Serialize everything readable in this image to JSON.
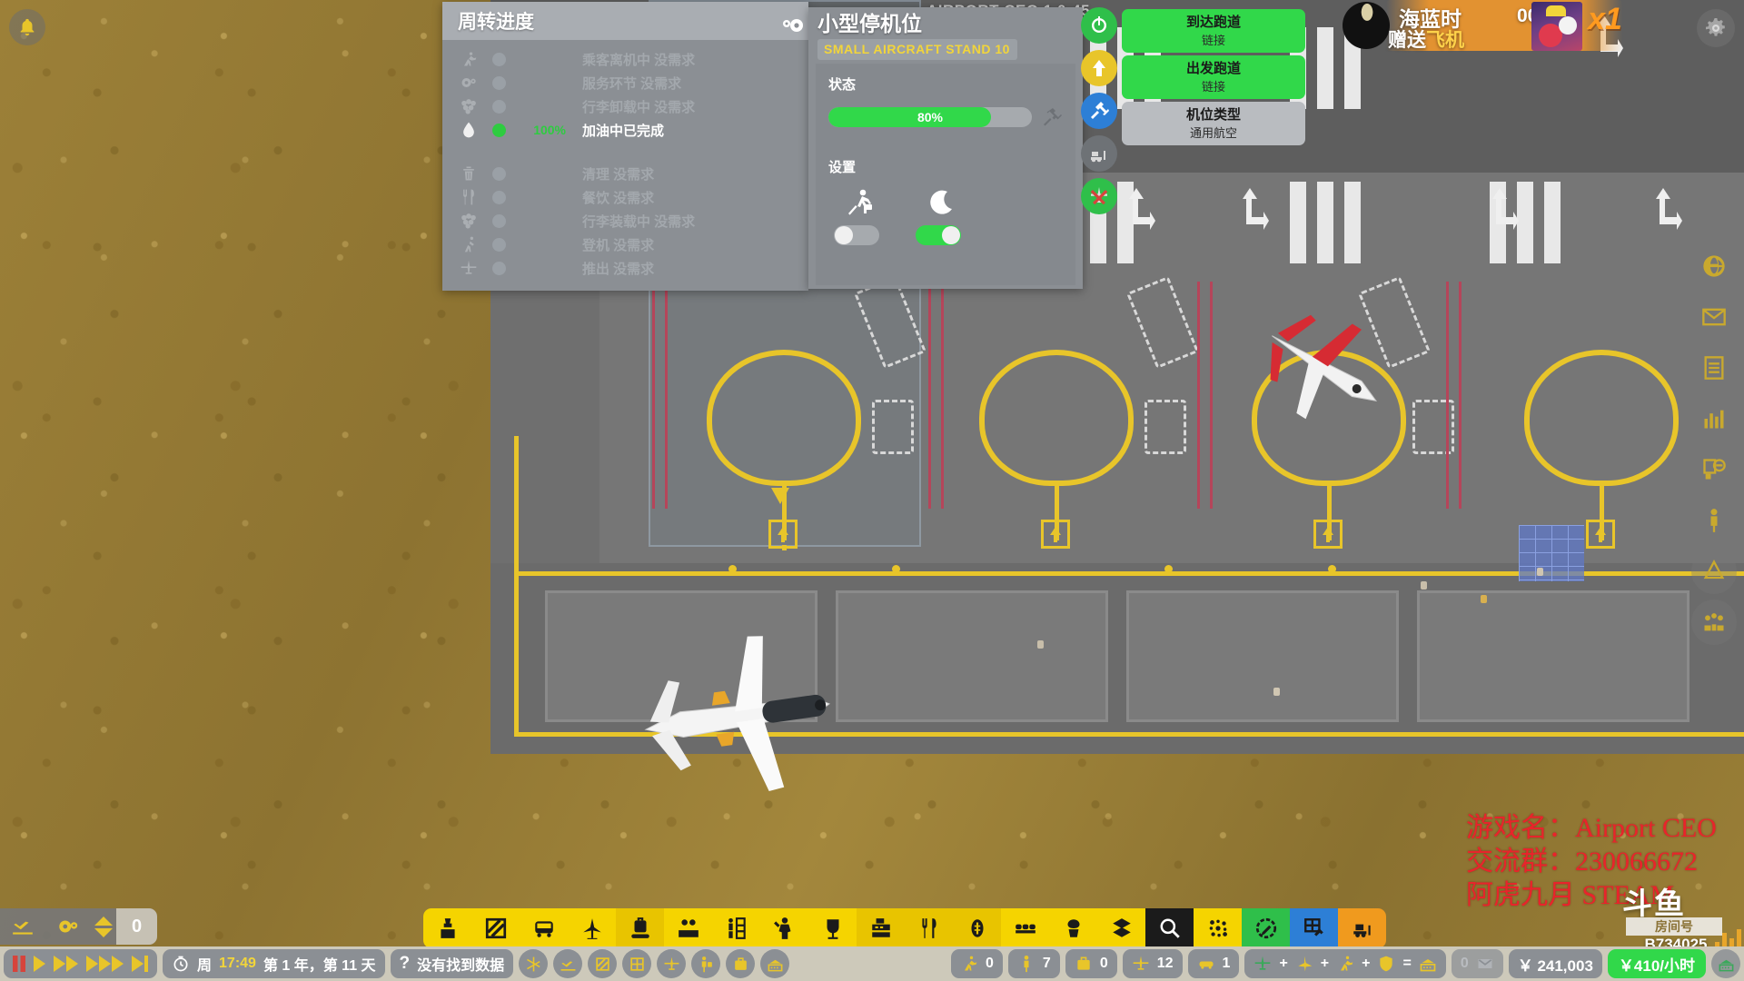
{
  "app": {
    "title": "AIRPORT CEO 1.0-45"
  },
  "top_left": {
    "bell_icon": "bell-icon"
  },
  "turnaround_panel": {
    "title": "周转进度",
    "rows": [
      {
        "icon": "passenger-deboard-icon",
        "label": "乘客离机中 没需求",
        "percent": "",
        "state": "idle"
      },
      {
        "icon": "service-gear-icon",
        "label": "服务环节 没需求",
        "percent": "",
        "state": "idle"
      },
      {
        "icon": "baggage-unload-icon",
        "label": "行李卸载中 没需求",
        "percent": "",
        "state": "idle"
      },
      {
        "icon": "fuel-drop-icon",
        "label": "加油中已完成",
        "percent": "100%",
        "state": "done"
      },
      {
        "icon": "trash-icon",
        "label": "清理 没需求",
        "percent": "",
        "state": "idle"
      },
      {
        "icon": "catering-icon",
        "label": "餐饮 没需求",
        "percent": "",
        "state": "idle"
      },
      {
        "icon": "baggage-load-icon",
        "label": "行李装载中 没需求",
        "percent": "",
        "state": "idle"
      },
      {
        "icon": "boarding-icon",
        "label": "登机 没需求",
        "percent": "",
        "state": "idle"
      },
      {
        "icon": "pushback-icon",
        "label": "推出 没需求",
        "percent": "",
        "state": "idle"
      }
    ]
  },
  "stand_panel": {
    "gear_icon": "gears-icon",
    "title": "小型停机位",
    "badge": "SMALL AIRCRAFT STAND 10",
    "status_label": "状态",
    "progress_percent": "80%",
    "progress_value": 80,
    "wrench_icon": "hammer-wrench-icon",
    "settings_label": "设置",
    "toggles": [
      {
        "icon": "passenger-walk-icon",
        "name": "allow-walk-boarding-toggle",
        "on": false
      },
      {
        "icon": "moon-icon",
        "name": "night-operations-toggle",
        "on": true
      }
    ]
  },
  "round_buttons": [
    {
      "name": "power-button",
      "icon": "power-icon",
      "color": "green"
    },
    {
      "name": "move-button",
      "icon": "arrow-up-icon",
      "color": "yellow"
    },
    {
      "name": "repair-button",
      "icon": "tools-icon",
      "color": "blue"
    },
    {
      "name": "bulldoze-button",
      "icon": "bulldozer-icon",
      "color": "gray"
    },
    {
      "name": "close-button",
      "icon": "close-plane-icon",
      "color": "green"
    }
  ],
  "link_buttons": [
    {
      "name": "arrival-runway-link",
      "title": "到达跑道",
      "sub": "链接",
      "style": "green"
    },
    {
      "name": "departure-runway-link",
      "title": "出发跑道",
      "sub": "链接",
      "style": "green"
    },
    {
      "name": "stand-type",
      "title": "机位类型",
      "sub": "通用航空",
      "style": "neutral"
    }
  ],
  "gift_overlay": {
    "username": "海蓝时",
    "timer": "00:0",
    "action_prefix": "赠送",
    "gift_name": "飞机",
    "multiplier": "x1"
  },
  "top_right": {
    "gear_icon": "gear-icon"
  },
  "right_rail": [
    {
      "name": "globe-icon"
    },
    {
      "name": "mail-icon"
    },
    {
      "name": "invoice-icon"
    },
    {
      "name": "chart-icon"
    },
    {
      "name": "contracts-icon"
    },
    {
      "name": "staff-icon"
    },
    {
      "name": "bell-alert-icon"
    },
    {
      "name": "people-icon"
    }
  ],
  "watermark": {
    "line1": "游戏名：Airport CEO",
    "line2": "交流群：230066672",
    "line3": "阿虎九月  STEAM",
    "platform": "斗鱼",
    "room_label": "房间号",
    "room_number": "B734025"
  },
  "build_toolbar": {
    "groups": [
      {
        "color": "yellow",
        "buttons": [
          {
            "name": "terminal-tool",
            "icon": "control-tower-icon"
          },
          {
            "name": "zones-tool",
            "icon": "hatch-square-icon"
          },
          {
            "name": "vehicle-tool",
            "icon": "bus-icon"
          },
          {
            "name": "runway-tool",
            "icon": "runway-plane-icon"
          }
        ]
      },
      {
        "color": "yellow-dim",
        "buttons": [
          {
            "name": "baggage-tool",
            "icon": "suitcase-belt-icon"
          }
        ]
      },
      {
        "color": "yellow",
        "buttons": [
          {
            "name": "staff-tool",
            "icon": "people-icon"
          },
          {
            "name": "shops-tool",
            "icon": "shop-shelf-icon"
          },
          {
            "name": "security-tool",
            "icon": "security-staff-icon"
          },
          {
            "name": "toilet-tool",
            "icon": "toilet-icon"
          }
        ]
      },
      {
        "color": "yellow-dim",
        "buttons": [
          {
            "name": "checkout-tool",
            "icon": "cash-register-icon"
          },
          {
            "name": "food-tool",
            "icon": "fork-knife-icon"
          },
          {
            "name": "money-tool",
            "icon": "coin-icon"
          }
        ]
      },
      {
        "color": "yellow",
        "buttons": [
          {
            "name": "seating-tool",
            "icon": "seats-icon"
          },
          {
            "name": "decor-tool",
            "icon": "plant-icon"
          },
          {
            "name": "misc-tool",
            "icon": "boxes-icon"
          }
        ]
      },
      {
        "color": "dark",
        "buttons": [
          {
            "name": "search-tool",
            "icon": "search-icon"
          }
        ]
      },
      {
        "color": "yellow",
        "buttons": [
          {
            "name": "scatter-tool",
            "icon": "dots-icon"
          }
        ]
      },
      {
        "color": "green",
        "buttons": [
          {
            "name": "paint-tool",
            "icon": "brush-clock-icon"
          }
        ]
      },
      {
        "color": "blue",
        "buttons": [
          {
            "name": "build-tool",
            "icon": "grid-tools-icon"
          }
        ]
      },
      {
        "color": "orange",
        "buttons": [
          {
            "name": "demolish-tool",
            "icon": "bulldozer-icon"
          }
        ]
      }
    ]
  },
  "bottom_left_control": {
    "takeoff_icon": "takeoff-icon",
    "gears_icon": "gears-icon",
    "stepper_icon": "stepper-icon",
    "value": "0"
  },
  "status_bar": {
    "speed_controls": [
      "pause-icon",
      "play-icon",
      "fast-forward-icon",
      "faster-forward-icon",
      "fastest-forward-icon"
    ],
    "clock_icon": "clock-icon",
    "weekday": "周",
    "time": "17:49",
    "date": "第 1 年，第 11 天",
    "help_icon": "question-icon",
    "help_text": "没有找到数据",
    "toggle_icons": [
      "snowflake-icon",
      "takeoff-icon",
      "hatch-square-icon",
      "grid-icon",
      "plane-icon",
      "staff-icon",
      "suitcase-icon",
      "terminal-icon"
    ],
    "counters": [
      {
        "icon": "deboard-icon",
        "value": "0",
        "name": "deboarding-count"
      },
      {
        "icon": "person-icon",
        "value": "7",
        "name": "passenger-count"
      },
      {
        "icon": "suitcase-icon",
        "value": "0",
        "name": "baggage-count"
      },
      {
        "icon": "plane-icon",
        "value": "12",
        "name": "aircraft-count"
      },
      {
        "icon": "vehicle-icon",
        "value": "1",
        "name": "vehicle-count"
      }
    ],
    "formula": {
      "icons": [
        "plane-green-icon",
        "jet-icon",
        "deboard-icon",
        "shield-icon"
      ],
      "plus": "+",
      "equals": "=",
      "result_icon": "terminal-icon"
    },
    "mail_count": "0",
    "mail_icon": "envelope-icon",
    "balance": "￥ 241,003",
    "income": "￥410/小时",
    "terminal_icon": "terminal-green-icon"
  }
}
